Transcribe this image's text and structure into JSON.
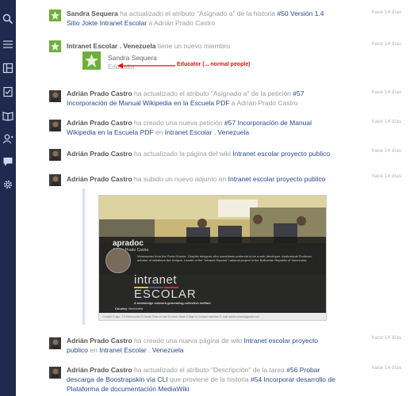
{
  "sidebar": {
    "icons": [
      "search-icon",
      "menu-icon",
      "layout-icon",
      "checklist-icon",
      "book-icon",
      "user-icon",
      "chat-icon",
      "gear-icon"
    ]
  },
  "feed": [
    {
      "user": "Sandra Sequera",
      "action": " ha actualizado el atributo \"Asignado a\" de la historia ",
      "link1": "#50 Versión 1.4 Sitio Jokte",
      "mid": " ",
      "link2": "Intranet Escolar",
      "tail": " a Adrián Prado Castro",
      "time": "hace 14 días"
    },
    {
      "user": "Intranet Escolar . Venezuela",
      "action": " tiene un nuevo miembro",
      "time": "hace 14 días",
      "member": {
        "name": "Sandra Sequera",
        "role": "Educador"
      },
      "annotation": "Educator (... normal people)"
    },
    {
      "user": "Adrián Prado Castro",
      "action": " ha actualizado el atributo \"Asignado a\" de la petición ",
      "link1": "#57 Incorporación de Manual Wikipedia en la Escuela PDF",
      "tail": " a Adrián Prado Castro",
      "time": "hace 14 días"
    },
    {
      "user": "Adrián Prado Castro",
      "action": " ha creado una nueva petición ",
      "link1": "#57 Incorporación de Manual Wikipedia en la Escuela PDF",
      "mid": " en ",
      "link2": "Intranet Escolar . Venezuela",
      "time": "hace 14 días"
    },
    {
      "user": "Adrián Prado Castro",
      "action": " ha actualizado la página del wiki ",
      "link1": "Intranet escolar proyecto publico",
      "time": "hace 14 días"
    },
    {
      "user": "Adrián Prado Castro",
      "action": " ha subido un nuevo adjunto en ",
      "link1": "Intranet escolar proyecto publico",
      "time": "hace 14 días"
    },
    {
      "user": "Adrián Prado Castro",
      "action": " ha creado una nueva página de wiki ",
      "link1": "Intranet escolar proyecto publico",
      "mid": " en ",
      "link2": "Intranet Escolar . Venezuela",
      "time": "hace 14 días"
    },
    {
      "user": "Adrián Prado Castro",
      "action": " ha actualizado el atributo \"Descripción\" de la tarea ",
      "link1": "#56 Probar descarga de Boostrapskin vía CLI",
      "mid": " que proviene de la historia ",
      "link2": "#54 Incorporar desarrollo de Plataforma de documentación MediaWiki",
      "time": "hace 14 días"
    }
  ],
  "attachment": {
    "title": "apradoc",
    "subtitle": "Adrián Prado Castro",
    "description": "Venezuelan from the Paria Grande. Graphic designer who sometimes pretends to be a web developer. Audiovisual Producer, admirer of initiatives like Kellyca. Leader of the \"Intranet Escolar\" national project in the Bolivarian Republic of Venezuela.",
    "logo_line1": "intranet",
    "logo_line2": "ESCOLAR",
    "tagline": "A knowledge network generating collective welfare",
    "country_label": "Country",
    "country": "Venezuela",
    "footer": "Created 3 ago, '15   Último post 21 horas   Time on site 11 mins   Views 3   Sign In Contact miembro   E-mail adrian.prado@gmail.com"
  }
}
